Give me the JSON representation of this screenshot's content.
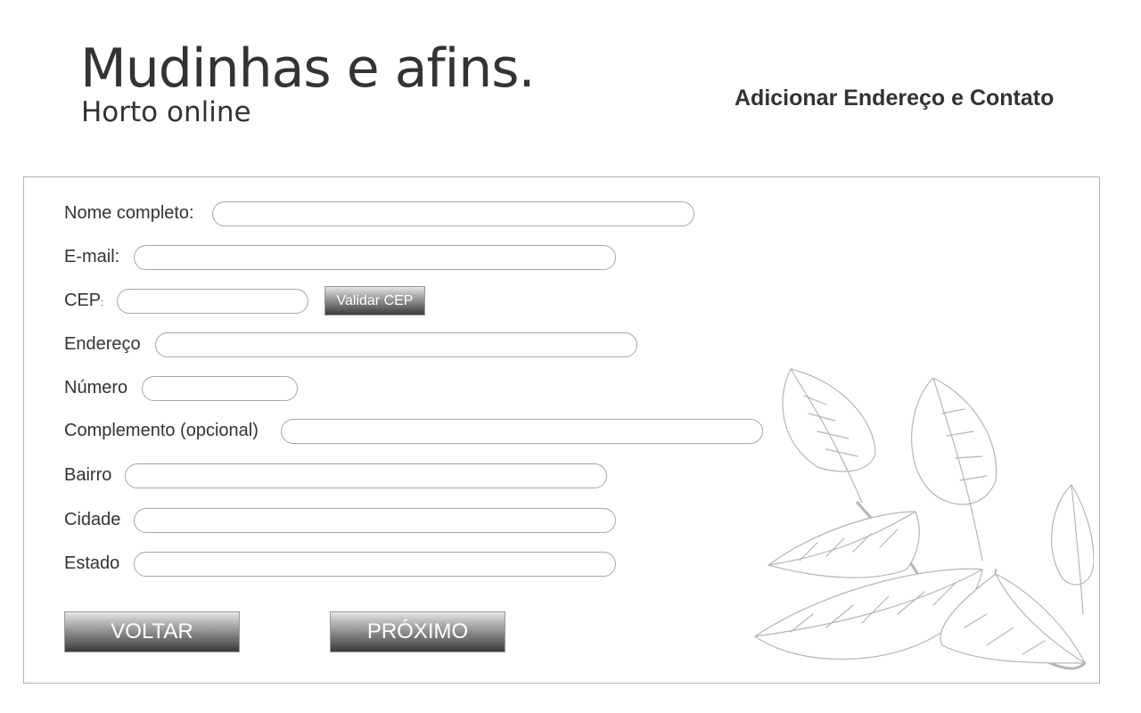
{
  "brand": {
    "title": "Mudinhas e afins.",
    "subtitle": "Horto online"
  },
  "page": {
    "heading": "Adicionar Endereço e Contato"
  },
  "form": {
    "fields": {
      "full_name": {
        "label": "Nome completo:",
        "value": "",
        "placeholder": ""
      },
      "email": {
        "label": "E-mail:",
        "value": "",
        "placeholder": ""
      },
      "cep": {
        "label": "CEP",
        "colon": ":",
        "value": "",
        "placeholder": ""
      },
      "address": {
        "label": "Endereço",
        "value": "",
        "placeholder": ""
      },
      "number": {
        "label": "Número",
        "value": "",
        "placeholder": ""
      },
      "complement": {
        "label": "Complemento (opcional)",
        "value": "",
        "placeholder": ""
      },
      "neighborhood": {
        "label": "Bairro",
        "value": "",
        "placeholder": ""
      },
      "city": {
        "label": "Cidade",
        "value": "",
        "placeholder": ""
      },
      "state": {
        "label": "Estado",
        "value": "",
        "placeholder": ""
      }
    },
    "validate_cep_label": "Validar CEP",
    "back_label": "VOLTAR",
    "next_label": "PRÓXIMO"
  },
  "decoration": {
    "illustration": "leaf-branch-sketch"
  },
  "colors": {
    "text": "#333333",
    "border": "#b3b3b3",
    "button_dark": "#3a3a3a",
    "button_light": "#e6e6e6",
    "illustration_stroke": "#b5b5b5"
  }
}
